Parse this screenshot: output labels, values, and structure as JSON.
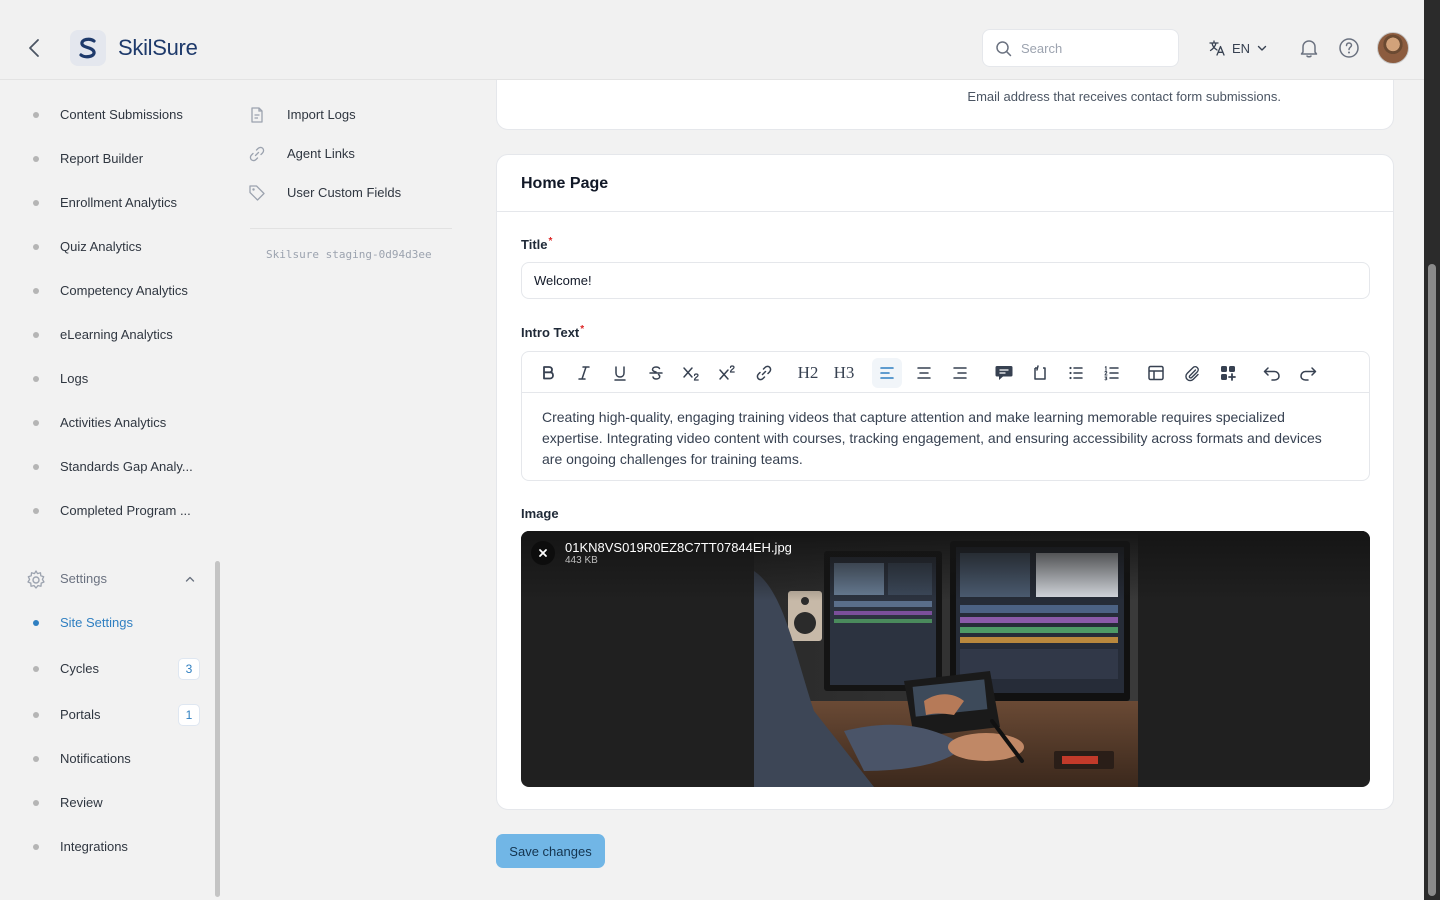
{
  "app": {
    "name": "SkilSure"
  },
  "header": {
    "search_placeholder": "Search",
    "language": "EN"
  },
  "sidebar": {
    "items": [
      {
        "label": "Content Submissions"
      },
      {
        "label": "Report Builder"
      },
      {
        "label": "Enrollment Analytics"
      },
      {
        "label": "Quiz Analytics"
      },
      {
        "label": "Competency Analytics"
      },
      {
        "label": "eLearning Analytics"
      },
      {
        "label": "Logs"
      },
      {
        "label": "Activities Analytics"
      },
      {
        "label": "Standards Gap Analy..."
      },
      {
        "label": "Completed Program ..."
      }
    ],
    "settings_label": "Settings",
    "settings_items": [
      {
        "label": "Site Settings",
        "active": true
      },
      {
        "label": "Cycles",
        "badge": "3"
      },
      {
        "label": "Portals",
        "badge": "1"
      },
      {
        "label": "Notifications"
      },
      {
        "label": "Review"
      },
      {
        "label": "Integrations"
      }
    ]
  },
  "subnav": {
    "items": [
      {
        "label": "Import Logs",
        "icon": "document-icon"
      },
      {
        "label": "Agent Links",
        "icon": "link-icon"
      },
      {
        "label": "User Custom Fields",
        "icon": "tag-icon"
      }
    ],
    "version": "Skilsure staging-0d94d3ee"
  },
  "contact_card": {
    "hint": "Email address that receives contact form submissions."
  },
  "home_page": {
    "title": "Home Page",
    "title_label": "Title",
    "title_value": "Welcome!",
    "intro_label": "Intro Text",
    "intro_text": "Creating high-quality, engaging training videos that capture attention and make learning memorable requires specialized expertise. Integrating video content with courses, tracking engagement, and ensuring accessibility across formats and devices are ongoing challenges for training teams.",
    "image_label": "Image",
    "image": {
      "file_name": "01KN8VS019R0EZ8C7TT07844EH.jpg",
      "file_size": "443 KB"
    },
    "toolbar": {
      "h2": "H2",
      "h3": "H3",
      "active_tool": "align-left"
    }
  },
  "actions": {
    "save_label": "Save changes"
  },
  "colors": {
    "accent": "#2f7fc1",
    "save_button": "#71b6e6",
    "required": "#dc2626"
  }
}
